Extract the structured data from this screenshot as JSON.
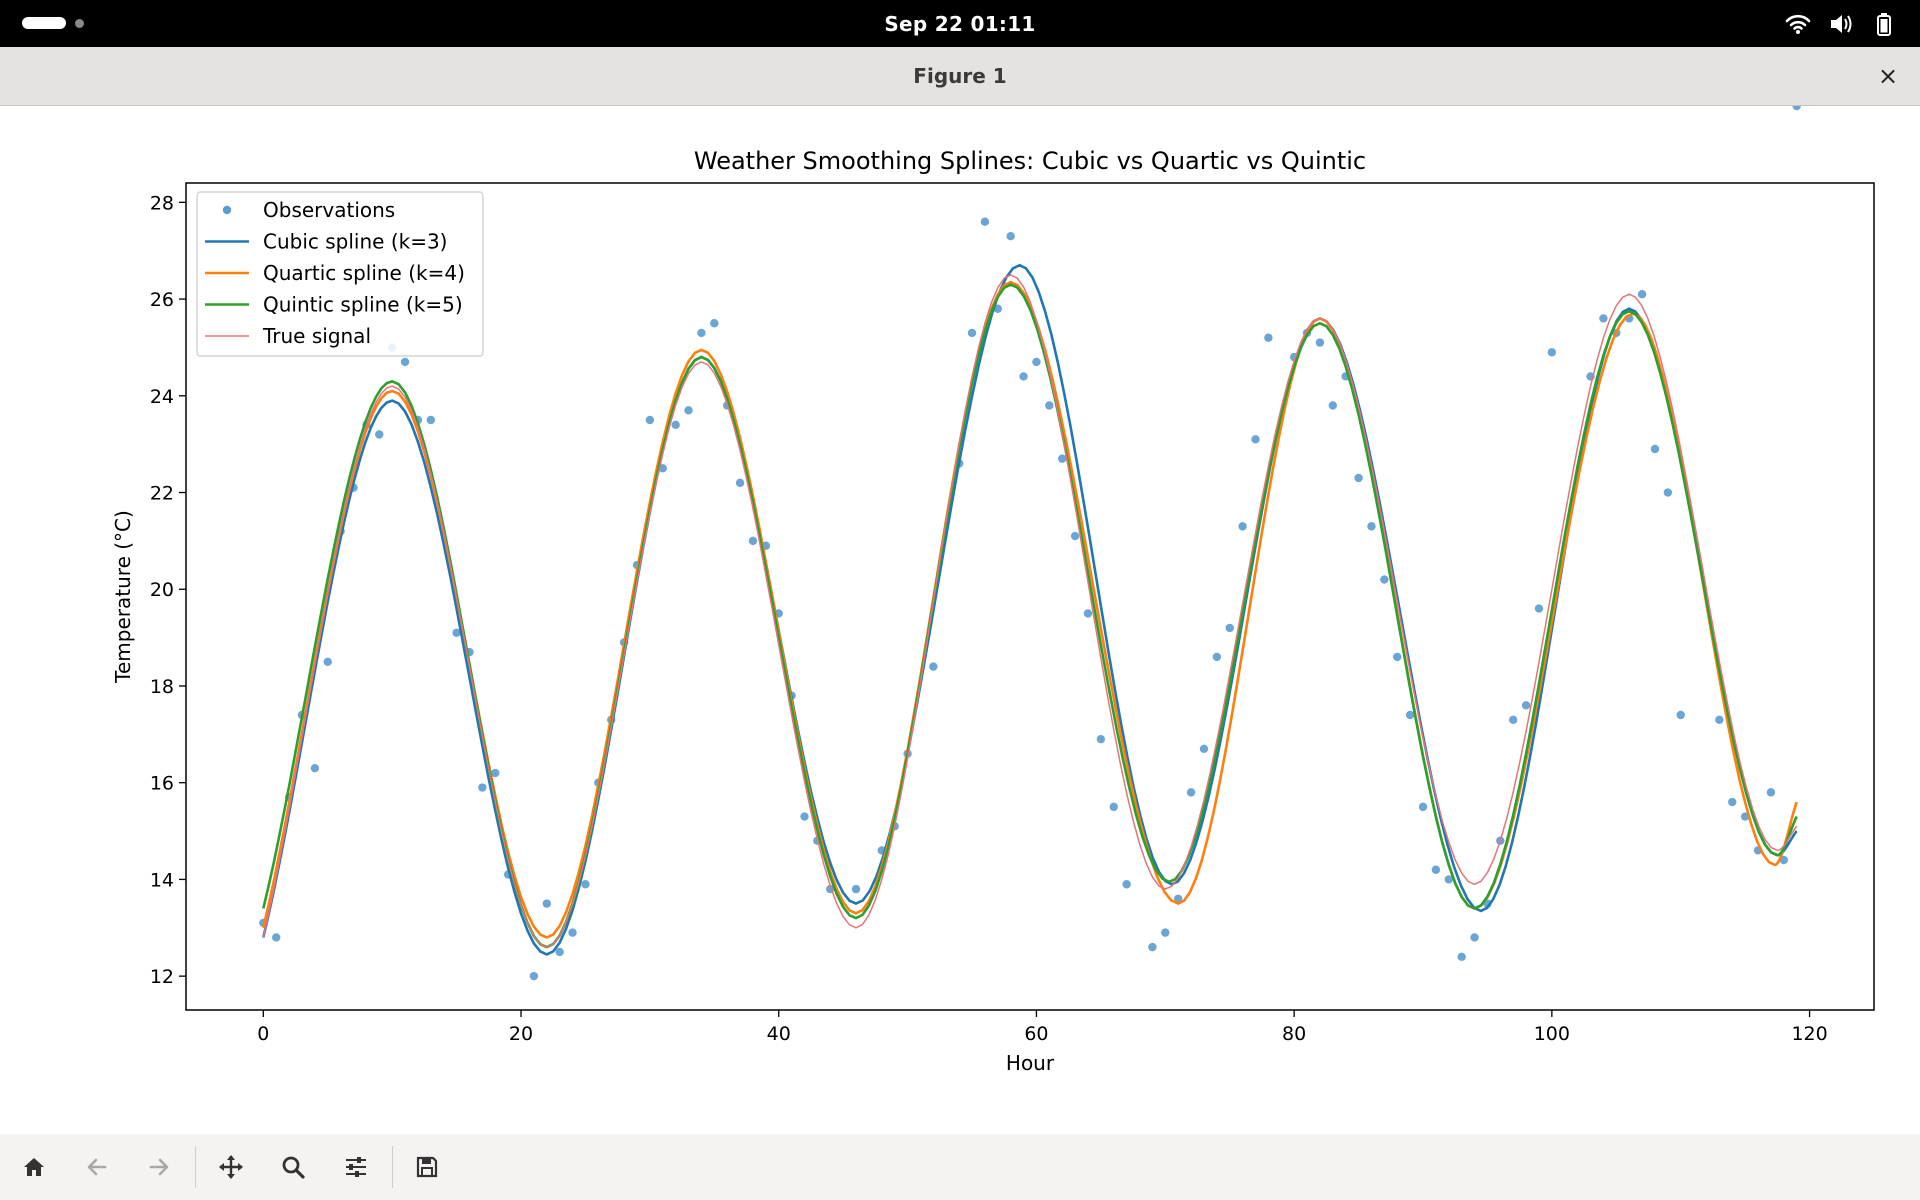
{
  "system_bar": {
    "clock": "Sep 22  01:11",
    "icons": [
      "wifi-icon",
      "volume-icon",
      "battery-icon"
    ]
  },
  "window": {
    "title": "Figure 1",
    "close_label": "×"
  },
  "toolbar": {
    "buttons": [
      "home-icon",
      "back-arrow-icon",
      "forward-arrow-icon",
      "pan-icon",
      "zoom-icon",
      "configure-subplots-icon",
      "save-icon"
    ]
  },
  "colors": {
    "cubic": "#1f77b4",
    "quartic": "#ff7f0e",
    "quintic": "#2ca02c",
    "true_signal": "#e8727a",
    "observations": "#5a9bd0"
  },
  "chart_data": {
    "type": "line",
    "title": "Weather Smoothing Splines: Cubic vs Quartic vs Quintic",
    "xlabel": "Hour",
    "ylabel": "Temperature (°C)",
    "xlim": [
      -6,
      125
    ],
    "ylim": [
      11.3,
      28.4
    ],
    "x_ticks": [
      0,
      20,
      40,
      60,
      80,
      100,
      120
    ],
    "y_ticks": [
      12,
      14,
      16,
      18,
      20,
      22,
      24,
      26,
      28
    ],
    "grid": false,
    "legend_position": "top-left",
    "legend": [
      "Observations",
      "Cubic spline (k=3)",
      "Quartic spline (k=4)",
      "Quintic spline (k=5)",
      "True signal"
    ],
    "observations": {
      "x": [
        0,
        1,
        2,
        3,
        4,
        5,
        6,
        7,
        8,
        9,
        10,
        11,
        12,
        13,
        15,
        16,
        17,
        18,
        19,
        21,
        22,
        23,
        24,
        25,
        26,
        27,
        28,
        29,
        30,
        31,
        32,
        33,
        34,
        35,
        36,
        37,
        38,
        39,
        40,
        41,
        42,
        43,
        44,
        46,
        48,
        49,
        50,
        52,
        54,
        55,
        56,
        57,
        58,
        59,
        60,
        61,
        62,
        63,
        64,
        65,
        66,
        67,
        69,
        70,
        71,
        72,
        73,
        74,
        75,
        76,
        77,
        78,
        80,
        81,
        82,
        83,
        84,
        85,
        86,
        87,
        88,
        89,
        90,
        91,
        92,
        93,
        94,
        95,
        96,
        97,
        98,
        99,
        100,
        103,
        104,
        105,
        106,
        107,
        108,
        109,
        110,
        113,
        114,
        115,
        116,
        117,
        118,
        119
      ],
      "y": [
        13.1,
        12.8,
        15.7,
        17.4,
        16.3,
        18.5,
        21.2,
        22.1,
        23.4,
        23.2,
        25.0,
        24.7,
        23.5,
        23.5,
        19.1,
        18.7,
        15.9,
        16.2,
        14.1,
        12.0,
        13.5,
        12.5,
        12.9,
        13.9,
        16.0,
        17.3,
        18.9,
        20.5,
        23.5,
        22.5,
        23.4,
        23.7,
        25.3,
        25.5,
        23.8,
        22.2,
        21.0,
        20.9,
        19.5,
        17.8,
        15.3,
        14.8,
        13.8,
        13.8,
        14.6,
        15.1,
        16.6,
        18.4,
        22.6,
        25.3,
        27.6,
        25.8,
        27.3,
        24.4,
        24.7,
        23.8,
        22.7,
        21.1,
        19.5,
        16.9,
        15.5,
        13.9,
        12.6,
        12.9,
        13.6,
        15.8,
        16.7,
        18.6,
        19.2,
        21.3,
        23.1,
        25.2,
        24.8,
        25.3,
        25.1,
        23.8,
        24.4,
        22.3,
        21.3,
        20.2,
        18.6,
        17.4,
        15.5,
        14.2,
        14.0,
        12.4,
        12.8,
        13.5,
        14.8,
        17.3,
        17.6,
        19.6,
        24.9,
        24.4,
        25.6,
        25.3,
        25.6,
        26.1,
        22.9,
        22.0,
        17.4,
        17.3,
        15.6,
        15.3,
        14.6,
        15.8,
        14.4
      ]
    },
    "series": [
      {
        "name": "Cubic spline (k=3)",
        "peaks_troughs": [
          [
            0,
            12.8
          ],
          [
            10,
            23.9
          ],
          [
            22,
            12.45
          ],
          [
            34,
            24.8
          ],
          [
            46,
            13.5
          ],
          [
            58.7,
            26.7
          ],
          [
            70.5,
            13.9
          ],
          [
            82,
            25.6
          ],
          [
            94.5,
            13.35
          ],
          [
            106,
            25.8
          ],
          [
            117.5,
            14.5
          ],
          [
            119,
            15.0
          ]
        ]
      },
      {
        "name": "Quartic spline (k=4)",
        "peaks_troughs": [
          [
            0,
            13.0
          ],
          [
            10,
            24.1
          ],
          [
            22,
            12.8
          ],
          [
            34,
            24.95
          ],
          [
            46,
            13.3
          ],
          [
            58,
            26.35
          ],
          [
            71,
            13.5
          ],
          [
            82,
            25.6
          ],
          [
            94,
            13.4
          ],
          [
            106.3,
            25.7
          ],
          [
            117.3,
            14.3
          ],
          [
            119,
            15.6
          ]
        ]
      },
      {
        "name": "Quintic spline (k=5)",
        "peaks_troughs": [
          [
            0,
            13.4
          ],
          [
            10,
            24.3
          ],
          [
            22,
            12.6
          ],
          [
            34,
            24.8
          ],
          [
            46,
            13.2
          ],
          [
            58,
            26.3
          ],
          [
            70.3,
            13.95
          ],
          [
            82,
            25.5
          ],
          [
            94,
            13.4
          ],
          [
            106,
            25.75
          ],
          [
            117.5,
            14.5
          ],
          [
            119,
            15.3
          ]
        ]
      },
      {
        "name": "True signal",
        "peaks_troughs": [
          [
            0,
            12.8
          ],
          [
            10,
            24.2
          ],
          [
            22,
            12.6
          ],
          [
            34,
            24.7
          ],
          [
            46,
            13.0
          ],
          [
            58,
            26.5
          ],
          [
            70,
            13.8
          ],
          [
            82,
            25.6
          ],
          [
            94,
            13.9
          ],
          [
            106,
            26.1
          ],
          [
            117.5,
            14.6
          ],
          [
            119,
            15.1
          ]
        ]
      }
    ]
  }
}
